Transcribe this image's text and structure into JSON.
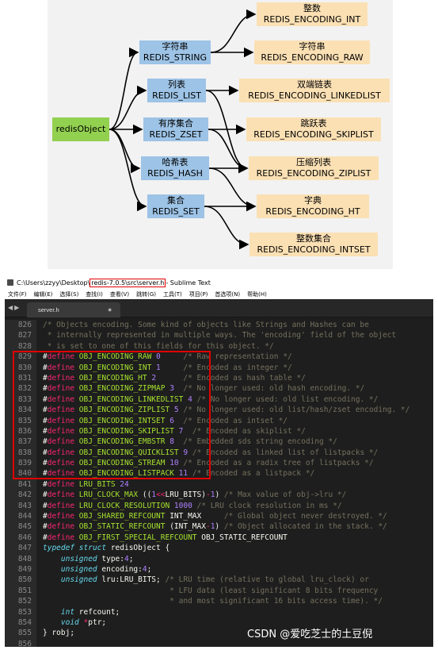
{
  "diagram": {
    "root": "redisObject",
    "types": [
      {
        "cn": "字符串",
        "en": "REDIS_STRING"
      },
      {
        "cn": "列表",
        "en": "REDIS_LIST"
      },
      {
        "cn": "有序集合",
        "en": "REDIS_ZSET"
      },
      {
        "cn": "哈希表",
        "en": "REDIS_HASH"
      },
      {
        "cn": "集合",
        "en": "REDIS_SET"
      }
    ],
    "encodings": [
      {
        "cn": "整数",
        "en": "REDIS_ENCODING_INT"
      },
      {
        "cn": "字符串",
        "en": "REDIS_ENCODING_RAW"
      },
      {
        "cn": "双端链表",
        "en": "REDIS_ENCODING_LINKEDLIST"
      },
      {
        "cn": "跳跃表",
        "en": "REDIS_ENCODING_SKIPLIST"
      },
      {
        "cn": "压缩列表",
        "en": "REDIS_ENCODING_ZIPLIST"
      },
      {
        "cn": "字典",
        "en": "REDIS_ENCODING_HT"
      },
      {
        "cn": "整数集合",
        "en": "REDIS_ENCODING_INTSET"
      }
    ],
    "edges": [
      [
        0,
        0
      ],
      [
        0,
        1
      ],
      [
        1,
        2
      ],
      [
        1,
        4
      ],
      [
        2,
        3
      ],
      [
        2,
        4
      ],
      [
        3,
        4
      ],
      [
        3,
        5
      ],
      [
        4,
        5
      ],
      [
        4,
        6
      ]
    ],
    "colors": {
      "root": "#92d050",
      "type": "#9dc3e6",
      "encoding": "#fbe0b4"
    }
  },
  "editor": {
    "title_prefix": "C:\\Users\\zzyy\\Desktop\\",
    "title_highlight": "redis-7.0.5\\src\\server.h",
    "title_suffix": " - Sublime Text",
    "menu": [
      "文件(F)",
      "编辑(E)",
      "选择(S)",
      "查找(I)",
      "查看(V)",
      "跳转(G)",
      "工具(T)",
      "项目(P)",
      "首选项(N)",
      "帮助(H)"
    ],
    "tab_name": "server.h",
    "lines": [
      {
        "n": "826",
        "t": [
          [
            "cm",
            "/* Objects encoding. Some kind of objects like Strings and Hashes can be"
          ]
        ]
      },
      {
        "n": "827",
        "t": [
          [
            "cm",
            " * internally represented in multiple ways. The 'encoding' field of the object"
          ]
        ]
      },
      {
        "n": "828",
        "t": [
          [
            "cm",
            " * is set to one of this fields for this object. */"
          ]
        ]
      },
      {
        "n": "829",
        "t": [
          [
            "pl",
            "#"
          ],
          [
            "kw",
            "define"
          ],
          [
            "pl",
            " "
          ],
          [
            "mac",
            "OBJ_ENCODING_RAW"
          ],
          [
            "pl",
            " "
          ],
          [
            "num",
            "0"
          ],
          [
            "pl",
            "     "
          ],
          [
            "cm",
            "/* Raw representation */"
          ]
        ]
      },
      {
        "n": "830",
        "t": [
          [
            "pl",
            "#"
          ],
          [
            "kw",
            "define"
          ],
          [
            "pl",
            " "
          ],
          [
            "mac",
            "OBJ_ENCODING_INT"
          ],
          [
            "pl",
            " "
          ],
          [
            "num",
            "1"
          ],
          [
            "pl",
            "     "
          ],
          [
            "cm",
            "/* Encoded as integer */"
          ]
        ]
      },
      {
        "n": "831",
        "t": [
          [
            "pl",
            "#"
          ],
          [
            "kw",
            "define"
          ],
          [
            "pl",
            " "
          ],
          [
            "mac",
            "OBJ_ENCODING_HT"
          ],
          [
            "pl",
            " "
          ],
          [
            "num",
            "2"
          ],
          [
            "pl",
            "      "
          ],
          [
            "cm",
            "/* Encoded as hash table */"
          ]
        ]
      },
      {
        "n": "832",
        "t": [
          [
            "pl",
            "#"
          ],
          [
            "kw",
            "define"
          ],
          [
            "pl",
            " "
          ],
          [
            "mac",
            "OBJ_ENCODING_ZIPMAP"
          ],
          [
            "pl",
            " "
          ],
          [
            "num",
            "3"
          ],
          [
            "pl",
            "  "
          ],
          [
            "cm",
            "/* No longer used: old hash encoding. */"
          ]
        ]
      },
      {
        "n": "833",
        "t": [
          [
            "pl",
            "#"
          ],
          [
            "kw",
            "define"
          ],
          [
            "pl",
            " "
          ],
          [
            "mac",
            "OBJ_ENCODING_LINKEDLIST"
          ],
          [
            "pl",
            " "
          ],
          [
            "num",
            "4"
          ],
          [
            "pl",
            " "
          ],
          [
            "cm",
            "/* No longer used: old list encoding. */"
          ]
        ]
      },
      {
        "n": "834",
        "t": [
          [
            "pl",
            "#"
          ],
          [
            "kw",
            "define"
          ],
          [
            "pl",
            " "
          ],
          [
            "mac",
            "OBJ_ENCODING_ZIPLIST"
          ],
          [
            "pl",
            " "
          ],
          [
            "num",
            "5"
          ],
          [
            "pl",
            " "
          ],
          [
            "cm",
            "/* No longer used: old list/hash/zset encoding. */"
          ]
        ]
      },
      {
        "n": "835",
        "t": [
          [
            "pl",
            "#"
          ],
          [
            "kw",
            "define"
          ],
          [
            "pl",
            " "
          ],
          [
            "mac",
            "OBJ_ENCODING_INTSET"
          ],
          [
            "pl",
            " "
          ],
          [
            "num",
            "6"
          ],
          [
            "pl",
            "  "
          ],
          [
            "cm",
            "/* Encoded as intset */"
          ]
        ]
      },
      {
        "n": "836",
        "t": [
          [
            "pl",
            "#"
          ],
          [
            "kw",
            "define"
          ],
          [
            "pl",
            " "
          ],
          [
            "mac",
            "OBJ_ENCODING_SKIPLIST"
          ],
          [
            "pl",
            " "
          ],
          [
            "num",
            "7"
          ],
          [
            "pl",
            "  "
          ],
          [
            "cm",
            "/* Encoded as skiplist */"
          ]
        ]
      },
      {
        "n": "837",
        "t": [
          [
            "pl",
            "#"
          ],
          [
            "kw",
            "define"
          ],
          [
            "pl",
            " "
          ],
          [
            "mac",
            "OBJ_ENCODING_EMBSTR"
          ],
          [
            "pl",
            " "
          ],
          [
            "num",
            "8"
          ],
          [
            "pl",
            "  "
          ],
          [
            "cm",
            "/* Embedded sds string encoding */"
          ]
        ]
      },
      {
        "n": "838",
        "t": [
          [
            "pl",
            "#"
          ],
          [
            "kw",
            "define"
          ],
          [
            "pl",
            " "
          ],
          [
            "mac",
            "OBJ_ENCODING_QUICKLIST"
          ],
          [
            "pl",
            " "
          ],
          [
            "num",
            "9"
          ],
          [
            "pl",
            " "
          ],
          [
            "cm",
            "/* Encoded as linked list of listpacks */"
          ]
        ]
      },
      {
        "n": "839",
        "t": [
          [
            "pl",
            "#"
          ],
          [
            "kw",
            "define"
          ],
          [
            "pl",
            " "
          ],
          [
            "mac",
            "OBJ_ENCODING_STREAM"
          ],
          [
            "pl",
            " "
          ],
          [
            "num",
            "10"
          ],
          [
            "pl",
            " "
          ],
          [
            "cm",
            "/* Encoded as a radix tree of listpacks */"
          ]
        ]
      },
      {
        "n": "840",
        "t": [
          [
            "pl",
            "#"
          ],
          [
            "kw",
            "define"
          ],
          [
            "pl",
            " "
          ],
          [
            "mac",
            "OBJ_ENCODING_LISTPACK"
          ],
          [
            "pl",
            " "
          ],
          [
            "num",
            "11"
          ],
          [
            "pl",
            " "
          ],
          [
            "cm",
            "/* Encoded as a listpack */"
          ]
        ]
      },
      {
        "n": "841",
        "t": [
          [
            "pl",
            "#"
          ],
          [
            "kw",
            "define"
          ],
          [
            "pl",
            " "
          ],
          [
            "mac",
            "LRU_BITS"
          ],
          [
            "pl",
            " "
          ],
          [
            "num",
            "24"
          ]
        ]
      },
      {
        "n": "842",
        "t": [
          [
            "pl",
            "#"
          ],
          [
            "kw",
            "define"
          ],
          [
            "pl",
            " "
          ],
          [
            "mac",
            "LRU_CLOCK_MAX"
          ],
          [
            "pl",
            " (("
          ],
          [
            "num",
            "1"
          ],
          [
            "kw",
            "<<"
          ],
          [
            "pl",
            "LRU_BITS)"
          ],
          [
            "kw",
            "-"
          ],
          [
            "num",
            "1"
          ],
          [
            "pl",
            ") "
          ],
          [
            "cm",
            "/* Max value of obj->lru */"
          ]
        ]
      },
      {
        "n": "843",
        "t": [
          [
            "pl",
            "#"
          ],
          [
            "kw",
            "define"
          ],
          [
            "pl",
            " "
          ],
          [
            "mac",
            "LRU_CLOCK_RESOLUTION"
          ],
          [
            "pl",
            " "
          ],
          [
            "num",
            "1000"
          ],
          [
            "pl",
            " "
          ],
          [
            "cm",
            "/* LRU clock resolution in ms */"
          ]
        ]
      },
      {
        "n": "844",
        "t": [
          [
            "pl",
            "#"
          ],
          [
            "kw",
            "define"
          ],
          [
            "pl",
            " "
          ],
          [
            "mac",
            "OBJ_SHARED_REFCOUNT"
          ],
          [
            "pl",
            " INT_MAX     "
          ],
          [
            "cm",
            "/* Global object never destroyed. */"
          ]
        ]
      },
      {
        "n": "845",
        "t": [
          [
            "pl",
            "#"
          ],
          [
            "kw",
            "define"
          ],
          [
            "pl",
            " "
          ],
          [
            "mac",
            "OBJ_STATIC_REFCOUNT"
          ],
          [
            "pl",
            " (INT_MAX"
          ],
          [
            "kw",
            "-"
          ],
          [
            "num",
            "1"
          ],
          [
            "pl",
            ") "
          ],
          [
            "cm",
            "/* Object allocated in the stack. */"
          ]
        ]
      },
      {
        "n": "846",
        "t": [
          [
            "pl",
            "#"
          ],
          [
            "kw",
            "define"
          ],
          [
            "pl",
            " "
          ],
          [
            "mac",
            "OBJ_FIRST_SPECIAL_REFCOUNT"
          ],
          [
            "pl",
            " OBJ_STATIC_REFCOUNT"
          ]
        ]
      },
      {
        "n": "847",
        "t": [
          [
            "ty",
            "typedef"
          ],
          [
            "pl",
            " "
          ],
          [
            "ty",
            "struct"
          ],
          [
            "pl",
            " redisObject {"
          ]
        ]
      },
      {
        "n": "848",
        "t": [
          [
            "pl",
            "    "
          ],
          [
            "ty",
            "unsigned"
          ],
          [
            "pl",
            " type:"
          ],
          [
            "num",
            "4"
          ],
          [
            "pl",
            ";"
          ]
        ]
      },
      {
        "n": "849",
        "t": [
          [
            "pl",
            "    "
          ],
          [
            "ty",
            "unsigned"
          ],
          [
            "pl",
            " encoding:"
          ],
          [
            "num",
            "4"
          ],
          [
            "pl",
            ";"
          ]
        ]
      },
      {
        "n": "850",
        "t": [
          [
            "pl",
            "    "
          ],
          [
            "ty",
            "unsigned"
          ],
          [
            "pl",
            " lru:LRU_BITS; "
          ],
          [
            "cm",
            "/* LRU time (relative to global lru_clock) or"
          ]
        ]
      },
      {
        "n": "851",
        "t": [
          [
            "pl",
            "                            "
          ],
          [
            "cm",
            "* LFU data (least significant 8 bits frequency"
          ]
        ]
      },
      {
        "n": "852",
        "t": [
          [
            "pl",
            "                            "
          ],
          [
            "cm",
            "* and most significant 16 bits access time). */"
          ]
        ]
      },
      {
        "n": "853",
        "t": [
          [
            "pl",
            "    "
          ],
          [
            "ty",
            "int"
          ],
          [
            "pl",
            " refcount;"
          ]
        ]
      },
      {
        "n": "854",
        "t": [
          [
            "pl",
            "    "
          ],
          [
            "ty",
            "void"
          ],
          [
            "pl",
            " "
          ],
          [
            "kw",
            "*"
          ],
          [
            "pl",
            "ptr;"
          ]
        ]
      },
      {
        "n": "855",
        "t": [
          [
            "pl",
            "} robj;"
          ]
        ]
      },
      {
        "n": "856",
        "t": []
      }
    ],
    "watermark": "CSDN @爱吃芝士的土豆倪"
  }
}
